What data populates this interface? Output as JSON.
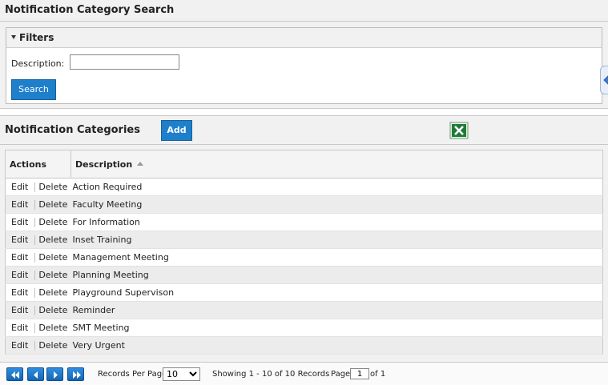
{
  "search_panel": {
    "title": "Notification Category Search",
    "filters_label": "Filters",
    "description_label": "Description:",
    "description_value": "",
    "search_button": "Search"
  },
  "categories_panel": {
    "title": "Notification Categories",
    "add_button": "Add",
    "export_icon": "excel-icon"
  },
  "grid": {
    "columns": [
      "Actions",
      "Description"
    ],
    "sort": {
      "column": "Description",
      "direction": "ascending"
    },
    "edit_label": "Edit",
    "delete_label": "Delete",
    "rows": [
      "Action Required",
      "Faculty Meeting",
      "For Information",
      "Inset Training",
      "Management Meeting",
      "Planning Meeting",
      "Playground Supervison",
      "Reminder",
      "SMT Meeting",
      "Very Urgent"
    ]
  },
  "pager": {
    "records_per_page_label": "Records Per Page",
    "records_per_page": "10",
    "showing_text": "Showing 1 - 10 of 10 Records",
    "page_label": "Page",
    "page_value": "1",
    "of_text": "of 1"
  },
  "colors": {
    "accent": "#1e7fcb",
    "header_bg": "#f1f1f1",
    "row_alt": "#ececec"
  }
}
